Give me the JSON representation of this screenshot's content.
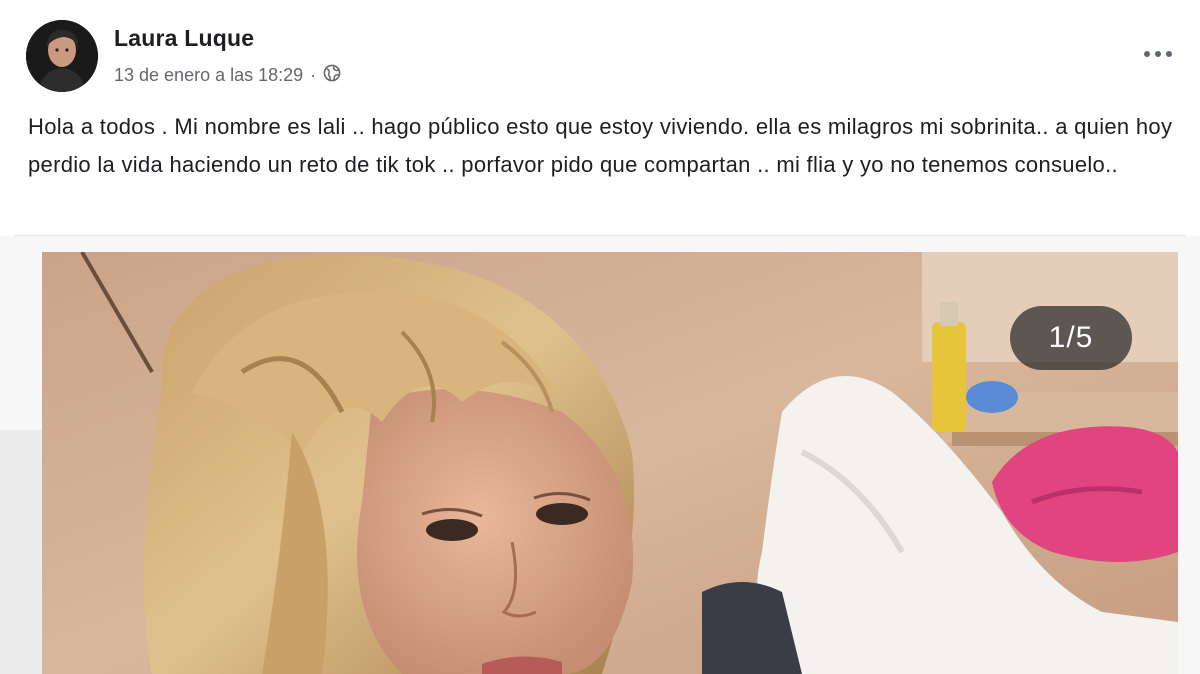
{
  "post": {
    "author": {
      "name": "Laura Luque"
    },
    "timestamp": "13 de enero a las 18:29",
    "separator": "·",
    "privacy_icon": "globe-icon",
    "more_icon": "more-options-icon",
    "text": "Hola a todos . Mi nombre es lali .. hago público  esto que estoy viviendo.  ella es milagros mi sobrinita.. a quien hoy perdio la vida haciendo un reto de tik tok .. porfavor pido que compartan .. mi flia y yo no tenemos consuelo..",
    "photo": {
      "counter": "1/5"
    }
  },
  "colors": {
    "name": "#1c1e21",
    "meta": "#65676b",
    "counter_bg": "rgba(40,40,40,0.72)"
  }
}
